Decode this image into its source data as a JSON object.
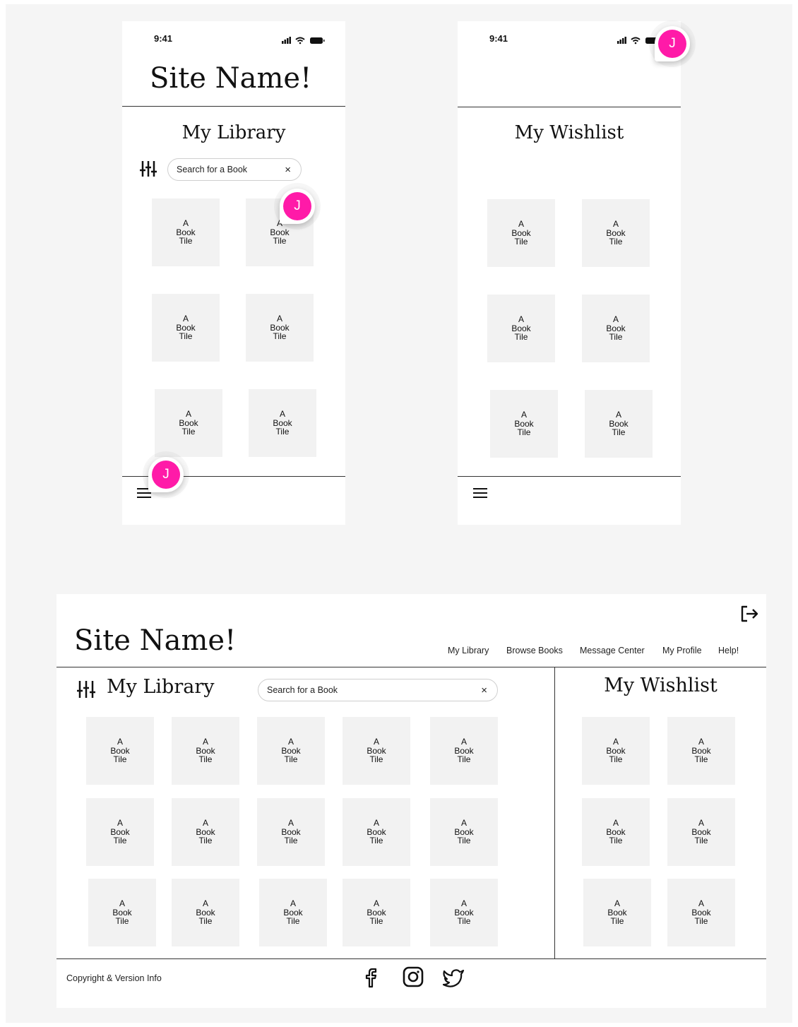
{
  "mobile_library": {
    "status_time": "9:41",
    "site_name": "Site Name!",
    "section_title": "My Library",
    "search_placeholder": "Search for a Book",
    "clear_icon": "×",
    "tiles": [
      "A Book Tile",
      "A Book Tile",
      "A Book Tile",
      "A Book Tile",
      "A Book Tile",
      "A Book Tile"
    ],
    "avatar_initial": "J"
  },
  "mobile_wishlist": {
    "status_time": "9:41",
    "section_title": "My Wishlist",
    "tiles": [
      "A Book Tile",
      "A Book Tile",
      "A Book Tile",
      "A Book Tile",
      "A Book Tile",
      "A Book Tile"
    ],
    "avatar_initial": "J"
  },
  "desktop": {
    "site_name": "Site Name!",
    "nav": [
      "My Library",
      "Browse Books",
      "Message Center",
      "My Profile",
      "Help!"
    ],
    "library_title": "My Library",
    "search_placeholder": "Search for a Book",
    "clear_icon": "×",
    "library_tiles": [
      "A Book Tile",
      "A Book Tile",
      "A Book Tile",
      "A Book Tile",
      "A Book Tile",
      "A Book Tile",
      "A Book Tile",
      "A Book Tile",
      "A Book Tile",
      "A Book Tile",
      "A Book Tile",
      "A Book Tile",
      "A Book Tile",
      "A Book Tile",
      "A Book Tile"
    ],
    "wishlist_title": "My Wishlist",
    "wishlist_tiles": [
      "A Book Tile",
      "A Book Tile",
      "A Book Tile",
      "A Book Tile",
      "A Book Tile",
      "A Book Tile"
    ],
    "footer_text": "Copyright & Version Info",
    "social_icons": [
      "facebook-icon",
      "instagram-icon",
      "twitter-icon"
    ]
  },
  "colors": {
    "avatar": "#ff1aa8",
    "tile": "#f2f2f2",
    "canvas": "#f5f5f5"
  }
}
